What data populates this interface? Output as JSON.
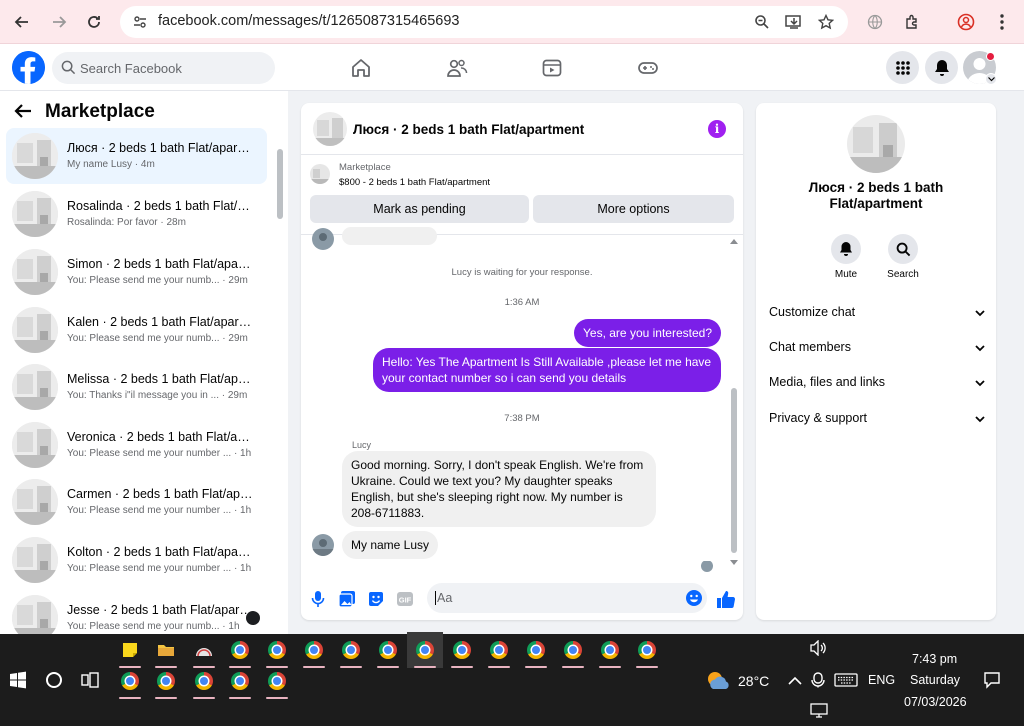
{
  "browser": {
    "url": "facebook.com/messages/t/1265087315465693"
  },
  "header": {
    "search_placeholder": "Search Facebook"
  },
  "sidebar": {
    "title": "Marketplace",
    "conversations": [
      {
        "title": "Люся · 2 beds 1 bath Flat/apartment",
        "preview": "My name Lusy · 4m"
      },
      {
        "title": "Rosalinda · 2 beds 1 bath Flat/apartment",
        "preview": "Rosalinda: Por favor · 28m"
      },
      {
        "title": "Simon · 2 beds 1 bath Flat/apartment",
        "preview": "You: Please send me your numb... · 29m"
      },
      {
        "title": "Kalen · 2 beds 1 bath Flat/apartment",
        "preview": "You: Please send me your numb... · 29m"
      },
      {
        "title": "Melissa · 2 beds 1 bath Flat/apartment",
        "preview": "You: Thanks i\"il message you in ... · 29m"
      },
      {
        "title": "Veronica · 2 beds 1 bath Flat/apartment",
        "preview": "You: Please send me your number ... · 1h"
      },
      {
        "title": "Carmen · 2 beds 1 bath Flat/apartment",
        "preview": "You: Please send me your number ... · 1h"
      },
      {
        "title": "Kolton · 2 beds 1 bath Flat/apartment",
        "preview": "You: Please send me your number ... · 1h"
      },
      {
        "title": "Jesse · 2 beds 1 bath Flat/apartment",
        "preview": "You: Please send me your numb... · 1h"
      }
    ]
  },
  "chat": {
    "title": "Люся · 2 beds 1 bath Flat/apartment",
    "marketplace_label": "Marketplace",
    "listing": "$800 - 2 beds 1 bath Flat/apartment",
    "mark_pending_label": "Mark as pending",
    "more_options_label": "More options",
    "waiting_text": "Lucy is waiting for your response.",
    "time_1": "1:36 AM",
    "msg_out_1": "Yes, are you interested?",
    "msg_out_2": "Hello: Yes The Apartment Is Still Available ,please let me have your contact number so i can send you details",
    "time_2": "7:38 PM",
    "sender_name": "Lucy",
    "msg_in_1": "Good morning. Sorry, I don't speak English. We're from Ukraine. Could we text you? My daughter speaks English, but she's sleeping right now. My number is 208-6711883.",
    "msg_in_2": "My name Lusy",
    "input_placeholder": "Aa"
  },
  "details": {
    "title": "Люся · 2 beds 1 bath Flat/apartment",
    "mute_label": "Mute",
    "search_label": "Search",
    "rows": [
      "Customize chat",
      "Chat members",
      "Media, files and links",
      "Privacy & support"
    ]
  },
  "taskbar": {
    "weather": "28°C",
    "language": "ENG",
    "time": "7:43 pm",
    "day": "Saturday",
    "date": "07/03/2026"
  },
  "colors": {
    "accent_purple": "#7b1fe8",
    "fb_blue": "#0866ff"
  }
}
